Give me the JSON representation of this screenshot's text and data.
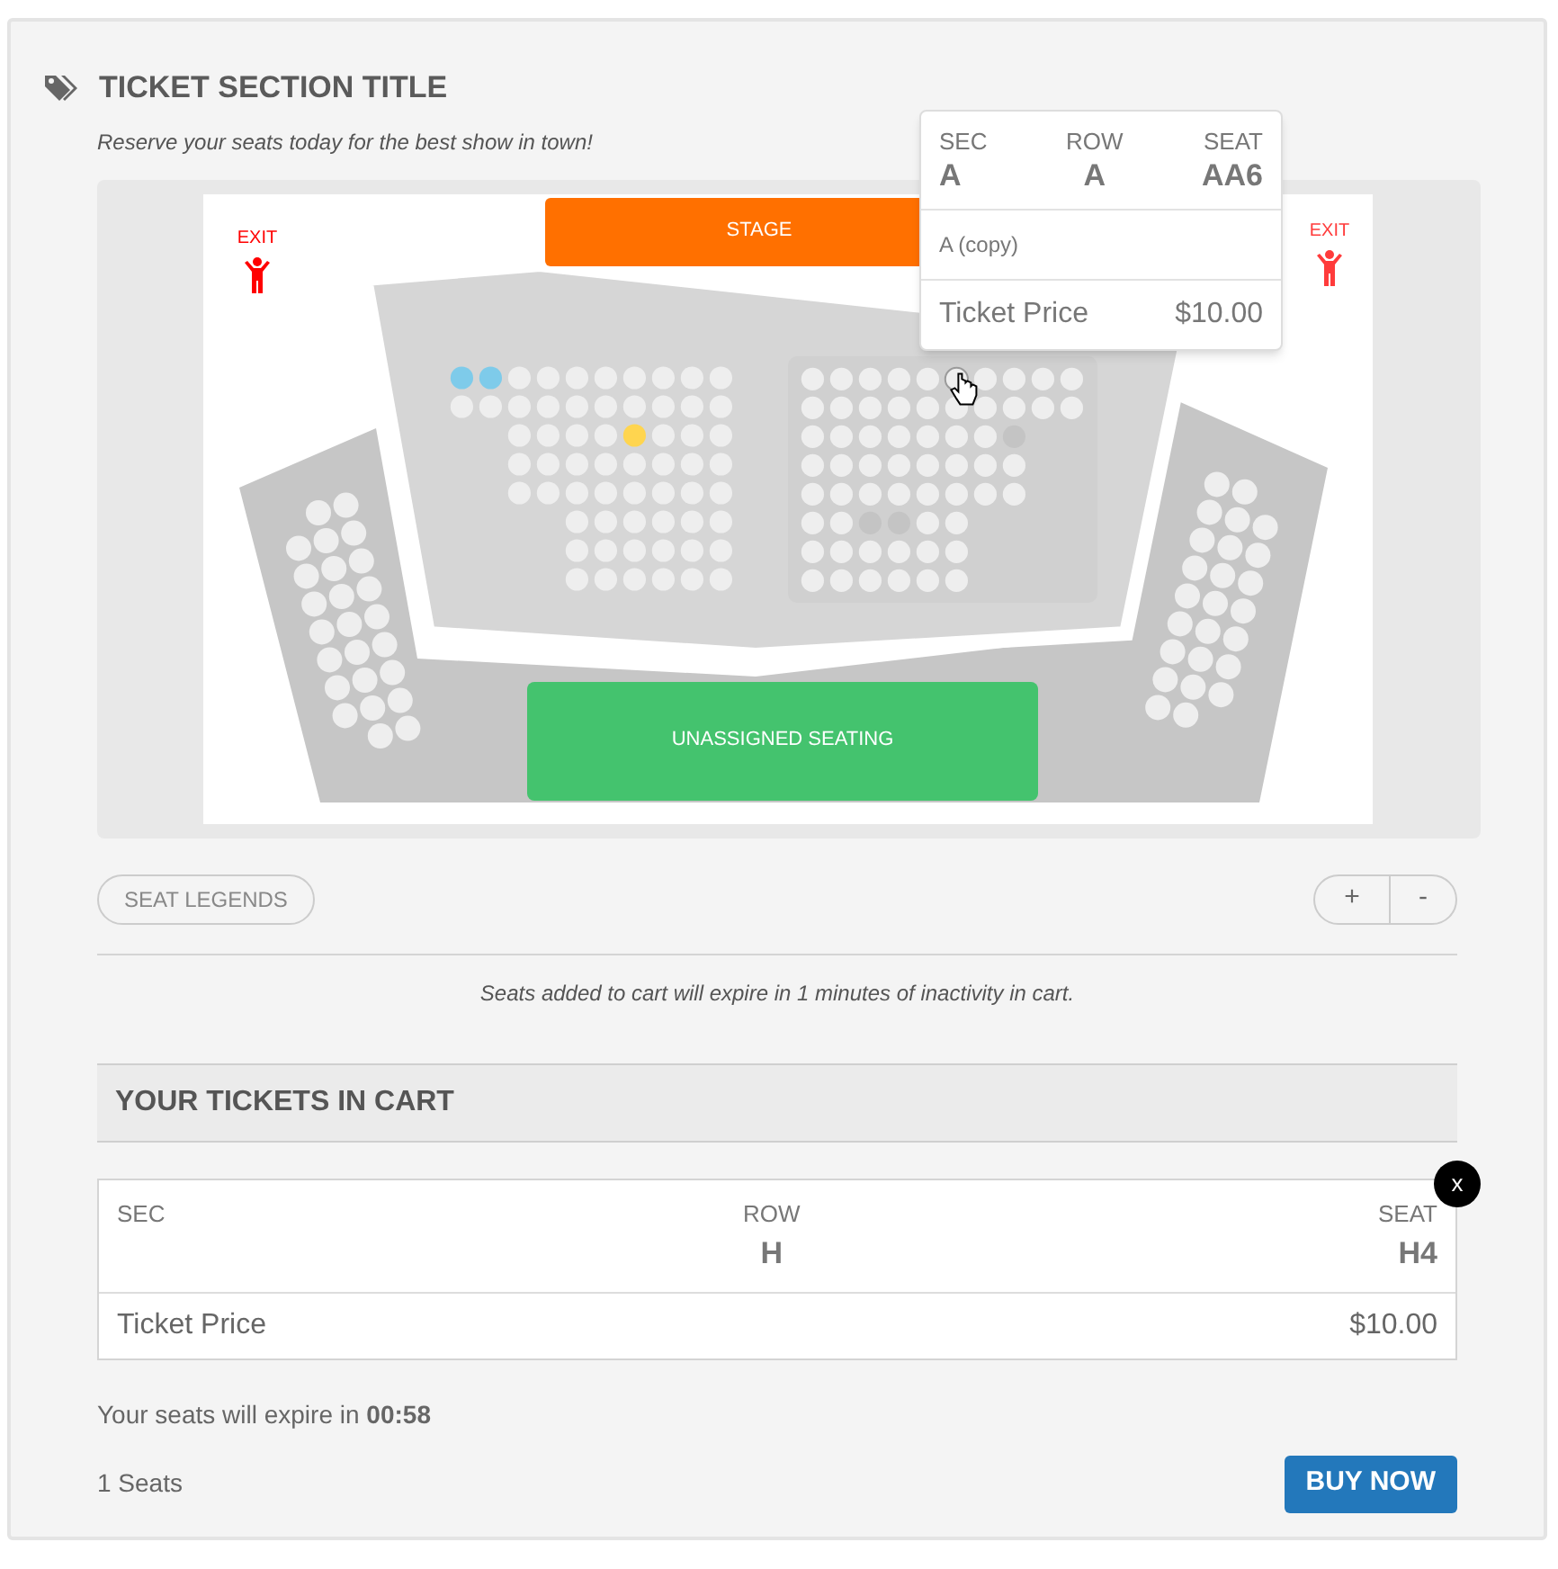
{
  "header": {
    "title": "TICKET SECTION TITLE",
    "subtitle": "Reserve your seats today for the best show in town!"
  },
  "seat_map": {
    "stage": "STAGE",
    "unassigned": "UNASSIGNED SEATING",
    "exits": [
      {
        "label": "EXIT"
      },
      {
        "label": "EXIT"
      }
    ],
    "sections": [
      {
        "kind": "wing-left",
        "rows": [
          [
            null,
            {
              "kind": "open"
            },
            {
              "kind": "open"
            }
          ],
          [
            {
              "kind": "open"
            },
            {
              "kind": "open"
            },
            {
              "kind": "open"
            }
          ],
          [
            {
              "kind": "open"
            },
            {
              "kind": "open"
            },
            {
              "kind": "open"
            }
          ],
          [
            {
              "kind": "open"
            },
            {
              "kind": "open"
            },
            {
              "kind": "open"
            }
          ],
          [
            {
              "kind": "open"
            },
            {
              "kind": "open"
            },
            {
              "kind": "open"
            }
          ],
          [
            {
              "kind": "open"
            },
            {
              "kind": "open"
            },
            {
              "kind": "open"
            }
          ],
          [
            {
              "kind": "open"
            },
            {
              "kind": "open"
            },
            {
              "kind": "open"
            }
          ],
          [
            {
              "kind": "open"
            },
            {
              "kind": "open"
            },
            {
              "kind": "open"
            }
          ],
          [
            null,
            {
              "kind": "open"
            },
            {
              "kind": "open"
            }
          ]
        ]
      },
      {
        "kind": "center-left",
        "rows": [
          [
            {
              "kind": "selected"
            },
            {
              "kind": "selected"
            },
            {
              "kind": "open"
            },
            {
              "kind": "open"
            },
            {
              "kind": "open"
            },
            {
              "kind": "open"
            },
            {
              "kind": "open"
            },
            {
              "kind": "open"
            },
            {
              "kind": "open"
            },
            {
              "kind": "open"
            }
          ],
          [
            {
              "kind": "open"
            },
            {
              "kind": "open"
            },
            {
              "kind": "open"
            },
            {
              "kind": "open"
            },
            {
              "kind": "open"
            },
            {
              "kind": "open"
            },
            {
              "kind": "open"
            },
            {
              "kind": "open"
            },
            {
              "kind": "open"
            },
            {
              "kind": "open"
            }
          ],
          [
            null,
            null,
            {
              "kind": "open"
            },
            {
              "kind": "open"
            },
            {
              "kind": "open"
            },
            {
              "kind": "open"
            },
            {
              "kind": "held"
            },
            {
              "kind": "open"
            },
            {
              "kind": "open"
            },
            {
              "kind": "open"
            }
          ],
          [
            null,
            null,
            {
              "kind": "open"
            },
            {
              "kind": "open"
            },
            {
              "kind": "open"
            },
            {
              "kind": "open"
            },
            {
              "kind": "open"
            },
            {
              "kind": "open"
            },
            {
              "kind": "open"
            },
            {
              "kind": "open"
            }
          ],
          [
            null,
            null,
            {
              "kind": "open"
            },
            {
              "kind": "open"
            },
            {
              "kind": "open"
            },
            {
              "kind": "open"
            },
            {
              "kind": "open"
            },
            {
              "kind": "open"
            },
            {
              "kind": "open"
            },
            {
              "kind": "open"
            }
          ],
          [
            null,
            null,
            null,
            null,
            {
              "kind": "open"
            },
            {
              "kind": "open"
            },
            {
              "kind": "open"
            },
            {
              "kind": "open"
            },
            {
              "kind": "open"
            },
            {
              "kind": "open"
            }
          ],
          [
            null,
            null,
            null,
            null,
            {
              "kind": "open"
            },
            {
              "kind": "open"
            },
            {
              "kind": "open"
            },
            {
              "kind": "open"
            },
            {
              "kind": "open"
            },
            {
              "kind": "open"
            }
          ],
          [
            null,
            null,
            null,
            null,
            {
              "kind": "open"
            },
            {
              "kind": "open"
            },
            {
              "kind": "open"
            },
            {
              "kind": "open"
            },
            {
              "kind": "open"
            },
            {
              "kind": "open"
            }
          ]
        ]
      },
      {
        "kind": "center-right",
        "rows": [
          [
            {
              "kind": "open"
            },
            {
              "kind": "open"
            },
            {
              "kind": "open"
            },
            {
              "kind": "open"
            },
            {
              "kind": "open"
            },
            {
              "kind": "hover"
            },
            {
              "kind": "open"
            },
            {
              "kind": "open"
            },
            {
              "kind": "open"
            },
            {
              "kind": "open"
            }
          ],
          [
            {
              "kind": "open"
            },
            {
              "kind": "open"
            },
            {
              "kind": "open"
            },
            {
              "kind": "open"
            },
            {
              "kind": "open"
            },
            {
              "kind": "open"
            },
            {
              "kind": "open"
            },
            {
              "kind": "open"
            },
            {
              "kind": "open"
            },
            {
              "kind": "open"
            }
          ],
          [
            {
              "kind": "open"
            },
            {
              "kind": "open"
            },
            {
              "kind": "open"
            },
            {
              "kind": "open"
            },
            {
              "kind": "open"
            },
            {
              "kind": "open"
            },
            {
              "kind": "open"
            },
            {
              "kind": "taken"
            }
          ],
          [
            {
              "kind": "open"
            },
            {
              "kind": "open"
            },
            {
              "kind": "open"
            },
            {
              "kind": "open"
            },
            {
              "kind": "open"
            },
            {
              "kind": "open"
            },
            {
              "kind": "open"
            },
            {
              "kind": "open"
            }
          ],
          [
            {
              "kind": "open"
            },
            {
              "kind": "open"
            },
            {
              "kind": "open"
            },
            {
              "kind": "open"
            },
            {
              "kind": "open"
            },
            {
              "kind": "open"
            },
            {
              "kind": "open"
            },
            {
              "kind": "open"
            }
          ],
          [
            {
              "kind": "open"
            },
            {
              "kind": "open"
            },
            {
              "kind": "taken"
            },
            {
              "kind": "taken"
            },
            {
              "kind": "open"
            },
            {
              "kind": "open"
            }
          ],
          [
            {
              "kind": "open"
            },
            {
              "kind": "open"
            },
            {
              "kind": "open"
            },
            {
              "kind": "open"
            },
            {
              "kind": "open"
            },
            {
              "kind": "open"
            }
          ],
          [
            {
              "kind": "open"
            },
            {
              "kind": "open"
            },
            {
              "kind": "open"
            },
            {
              "kind": "open"
            },
            {
              "kind": "open"
            },
            {
              "kind": "open"
            }
          ]
        ]
      },
      {
        "kind": "wing-right",
        "rows": [
          [
            {
              "kind": "open"
            },
            {
              "kind": "open"
            }
          ],
          [
            {
              "kind": "open"
            },
            {
              "kind": "open"
            },
            {
              "kind": "open"
            }
          ],
          [
            {
              "kind": "open"
            },
            {
              "kind": "open"
            },
            {
              "kind": "open"
            }
          ],
          [
            {
              "kind": "open"
            },
            {
              "kind": "open"
            },
            {
              "kind": "open"
            }
          ],
          [
            {
              "kind": "open"
            },
            {
              "kind": "open"
            },
            {
              "kind": "open"
            }
          ],
          [
            {
              "kind": "open"
            },
            {
              "kind": "open"
            },
            {
              "kind": "open"
            }
          ],
          [
            {
              "kind": "open"
            },
            {
              "kind": "open"
            },
            {
              "kind": "open"
            }
          ],
          [
            {
              "kind": "open"
            },
            {
              "kind": "open"
            },
            {
              "kind": "open"
            }
          ],
          [
            {
              "kind": "open"
            },
            {
              "kind": "open"
            }
          ]
        ]
      }
    ],
    "tooltip": {
      "sec_label": "SEC",
      "sec": "A",
      "row_label": "ROW",
      "row": "A",
      "seat_label": "SEAT",
      "seat": "AA6",
      "section_name": "A (copy)",
      "price_label": "Ticket Price",
      "price": "$10.00"
    }
  },
  "legend_button": "SEAT LEGENDS",
  "zoom_buttons": [
    "+",
    "-"
  ],
  "notice": "Seats added to cart will expire in 1 minutes of inactivity in cart.",
  "cart": {
    "title": "YOUR TICKETS IN CART",
    "tickets": [
      {
        "sec_label": "SEC",
        "row_label": "ROW",
        "row": "H",
        "seat_label": "SEAT",
        "seat": "H4",
        "price_label": "Ticket Price",
        "price": "$10.00",
        "remove": "x"
      }
    ],
    "expire": "Your seats will expire in **00:58**",
    "count": "1 Seats",
    "buy": "BUY NOW"
  }
}
